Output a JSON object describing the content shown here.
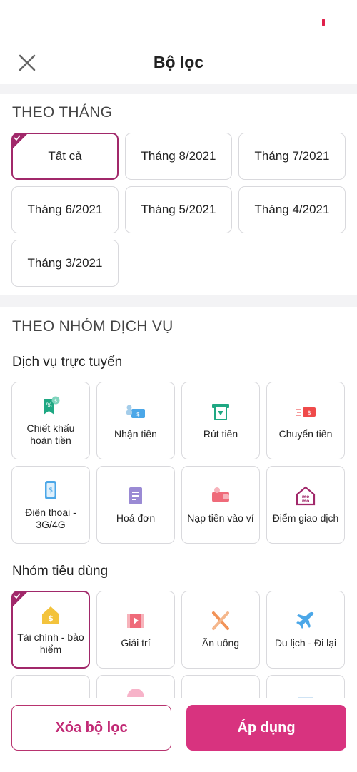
{
  "header": {
    "title": "Bộ lọc"
  },
  "month_section": {
    "title": "THEO THÁNG",
    "chips": [
      {
        "label": "Tất cả",
        "selected": true
      },
      {
        "label": "Tháng 8/2021",
        "selected": false
      },
      {
        "label": "Tháng 7/2021",
        "selected": false
      },
      {
        "label": "Tháng 6/2021",
        "selected": false
      },
      {
        "label": "Tháng 5/2021",
        "selected": false
      },
      {
        "label": "Tháng 4/2021",
        "selected": false
      },
      {
        "label": "Tháng 3/2021",
        "selected": false
      }
    ]
  },
  "service_section": {
    "title": "THEO NHÓM DỊCH VỤ",
    "online": {
      "title": "Dịch vụ trực tuyến",
      "items": [
        {
          "label": "Chiết khấu hoàn tiền",
          "icon": "cashback-icon"
        },
        {
          "label": "Nhận tiền",
          "icon": "receive-money-icon"
        },
        {
          "label": "Rút tiền",
          "icon": "withdraw-icon"
        },
        {
          "label": "Chuyển tiền",
          "icon": "transfer-icon"
        },
        {
          "label": "Điện thoại - 3G/4G",
          "icon": "phone-topup-icon"
        },
        {
          "label": "Hoá đơn",
          "icon": "bill-icon"
        },
        {
          "label": "Nạp tiền vào ví",
          "icon": "wallet-topup-icon"
        },
        {
          "label": "Điểm giao dịch",
          "icon": "transaction-point-icon"
        }
      ]
    },
    "consumer": {
      "title": "Nhóm tiêu dùng",
      "items": [
        {
          "label": "Tài chính - bảo hiểm",
          "icon": "finance-icon",
          "selected": true
        },
        {
          "label": "Giải trí",
          "icon": "entertainment-icon",
          "selected": false
        },
        {
          "label": "Ăn uống",
          "icon": "food-icon",
          "selected": false
        },
        {
          "label": "Du lịch - Đi lại",
          "icon": "travel-icon",
          "selected": false
        }
      ]
    }
  },
  "footer": {
    "clear_label": "Xóa bộ lọc",
    "apply_label": "Áp dụng"
  },
  "colors": {
    "brand": "#a1286a",
    "apply": "#d8337f",
    "clear_text": "#c22a75"
  }
}
